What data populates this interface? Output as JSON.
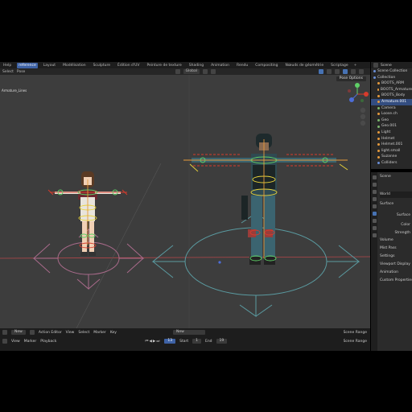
{
  "topbar": {
    "menu": [
      "Help"
    ],
    "tabs": [
      "Layout",
      "Modélisation",
      "Sculpture",
      "Édition d'UV",
      "Peinture de texture",
      "Shading",
      "Animation",
      "Rendu",
      "Compositing",
      "Nœuds de géométrie",
      "Scriptage"
    ],
    "active_tab": "Layout",
    "active_prefix": "reference",
    "plus": "+"
  },
  "viewport_header": {
    "select": "Select",
    "pose": "Pose",
    "orientation": "Global",
    "pose_options": "Pose Options"
  },
  "viewport": {
    "label": "Armature_Lines"
  },
  "outliner": {
    "header": "Scene",
    "items": [
      {
        "label": "Scene Collection",
        "kind": "b"
      },
      {
        "label": "Collection",
        "kind": "b"
      },
      {
        "label": "BOOTS_ARM",
        "kind": "o"
      },
      {
        "label": "BOOTS_Armature",
        "kind": "o"
      },
      {
        "label": "BOOTS_Body",
        "kind": "o"
      },
      {
        "label": "Armature.001",
        "kind": "o",
        "selected": true
      },
      {
        "label": "Camera",
        "kind": "g"
      },
      {
        "label": "Loose.ch",
        "kind": "o"
      },
      {
        "label": "Geo",
        "kind": "g"
      },
      {
        "label": "Geo.001",
        "kind": "g"
      },
      {
        "label": "Light",
        "kind": "o"
      },
      {
        "label": "Helmet",
        "kind": "o"
      },
      {
        "label": "Helmet.001",
        "kind": "o"
      },
      {
        "label": "light.small",
        "kind": "o"
      },
      {
        "label": "Suzanne",
        "kind": "o"
      },
      {
        "label": "Colliders",
        "kind": "b"
      }
    ]
  },
  "properties": {
    "scene": "Scene",
    "world": "World",
    "sections": [
      "Surface",
      "Volume",
      "Mist Pass",
      "Settings",
      "Viewport Display",
      "Animation",
      "Custom Properties"
    ],
    "fields": [
      "Surface",
      "Color",
      "Strength"
    ]
  },
  "timeline": {
    "row1": {
      "view_label": "New",
      "editor": "Action Editor",
      "view": "View",
      "select": "Select",
      "marker": "Marker",
      "key": "Key",
      "new_btn": "New",
      "scene_range": "Scene Range"
    },
    "row2": {
      "view": "View",
      "marker": "Marker",
      "playback": "Playback",
      "current_frame": "13",
      "start_label": "Start",
      "start": "1",
      "end_label": "End",
      "end": "19",
      "scene_range": "Scene Range"
    }
  },
  "colors": {
    "accent": "#3e62a5",
    "viewport_bg": "#3d3d3d",
    "panel_bg": "#282828",
    "bone_orange": "#e69a3c",
    "bone_red": "#d83b2c",
    "bone_green": "#5fd067",
    "bone_yellow": "#e8d23a"
  }
}
